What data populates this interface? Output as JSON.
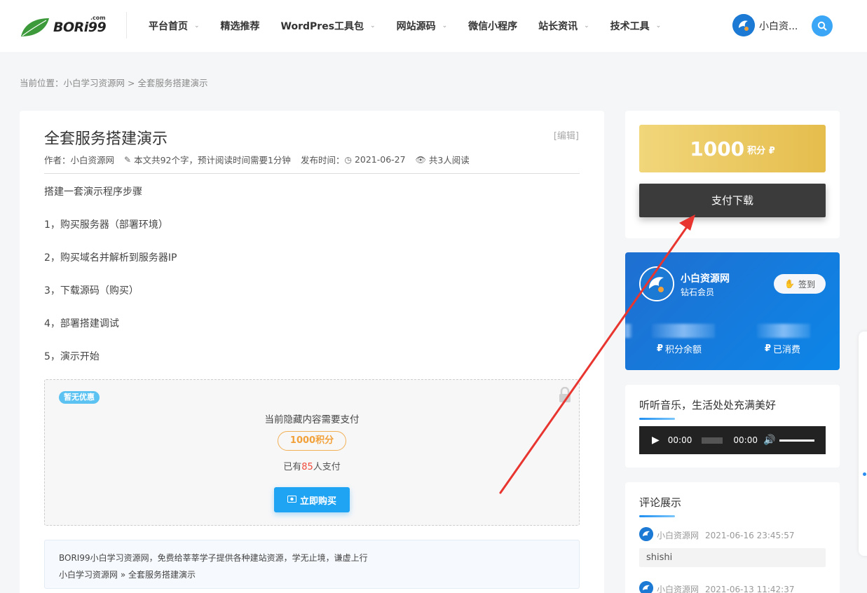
{
  "header": {
    "logo_text": "BORi99",
    "logo_com": ".com",
    "nav": [
      {
        "label": "平台首页",
        "dropdown": true
      },
      {
        "label": "精选推荐",
        "dropdown": false
      },
      {
        "label": "WordPres工具包",
        "dropdown": true
      },
      {
        "label": "网站源码",
        "dropdown": true
      },
      {
        "label": "微信小程序",
        "dropdown": false
      },
      {
        "label": "站长资讯",
        "dropdown": true
      },
      {
        "label": "技术工具",
        "dropdown": true
      }
    ],
    "user_name": "小白资...",
    "search_icon": "search-icon"
  },
  "breadcrumb": {
    "prefix": "当前位置：",
    "home": "小白学习资源网",
    "sep": ">",
    "current": "全套服务搭建演示"
  },
  "post": {
    "title": "全套服务搭建演示",
    "edit": "[编辑]",
    "meta": {
      "author": "作者：小白资源网",
      "words": "本文共92个字，预计阅读时间需要1分钟",
      "date_label": "发布时间：",
      "date": "2021-06-27",
      "views": "共3人阅读"
    },
    "paragraphs": [
      "搭建一套演示程序步骤",
      "1，购买服务器（部署环境）",
      "2，购买域名并解析到服务器IP",
      "3，下载源码（购买）",
      "4，部署搭建调试",
      "5，演示开始"
    ],
    "hidden": {
      "tag": "暂无优惠",
      "note": "当前隐藏内容需要支付",
      "price": "1000积分",
      "paid_prefix": "已有",
      "paid_num": "85",
      "paid_suffix": "人支付",
      "buy_label": "立即购买"
    },
    "info": {
      "line1": "BORI99小白学习资源网，免费给莘莘学子提供各种建站资源，学无止境，谦虚上行",
      "line2": "小白学习资源网 » 全套服务搭建演示"
    }
  },
  "sidebar": {
    "price_num": "1000",
    "price_unit": "积分 ₽",
    "pay_label": "支付下载",
    "user": {
      "name": "小白资源网",
      "level": "钻石会员",
      "checkin": "签到",
      "balance_label": "积分余额",
      "spent_label": "已消费"
    },
    "music": {
      "title": "听听音乐，生活处处充满美好",
      "time_current": "00:00",
      "time_total": "00:00"
    },
    "comments": {
      "title": "评论展示",
      "items": [
        {
          "author": "小白资源网",
          "time": "2021-06-16 23:45:57",
          "body": "shishi"
        },
        {
          "author": "小白资源网",
          "time": "2021-06-13 11:42:37",
          "body": ""
        }
      ]
    }
  },
  "colors": {
    "accent": "#1fa3f3",
    "gold": "#e5bd4d",
    "arrow": "#e8352f"
  }
}
